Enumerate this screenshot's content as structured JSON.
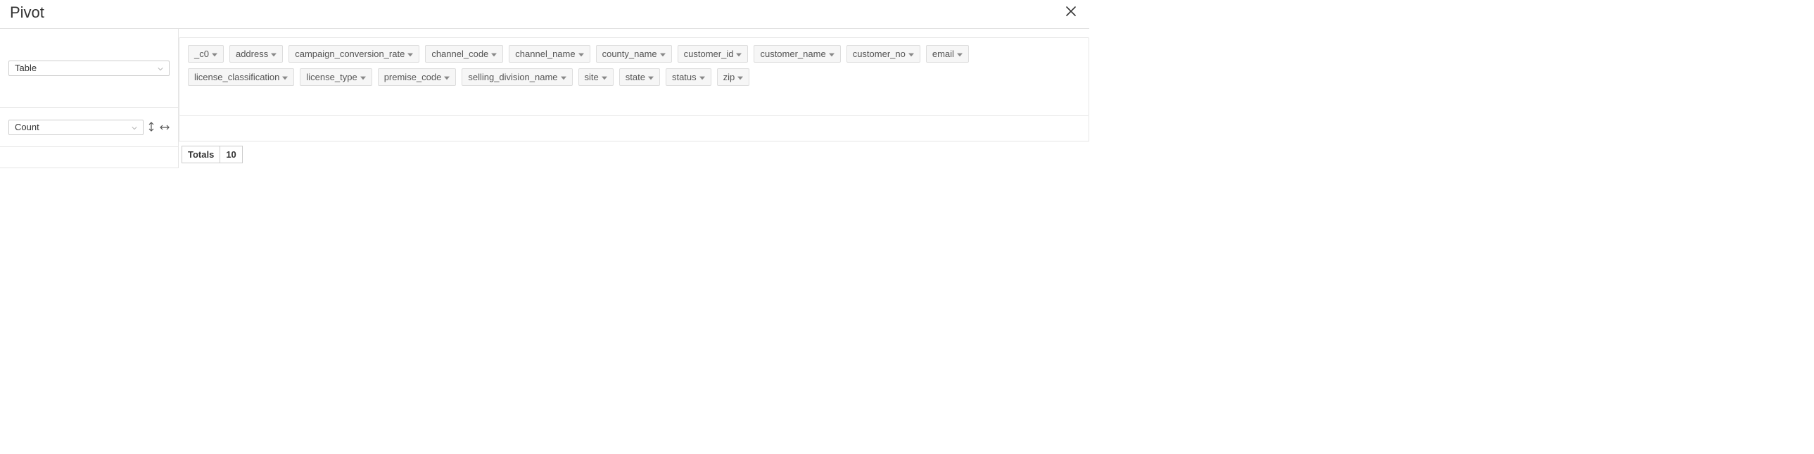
{
  "header": {
    "title": "Pivot"
  },
  "left": {
    "renderer": "Table",
    "aggregator": "Count"
  },
  "fields": {
    "unused": [
      "_c0",
      "address",
      "campaign_conversion_rate",
      "channel_code",
      "channel_name",
      "county_name",
      "customer_id",
      "customer_name",
      "customer_no",
      "email",
      "license_classification",
      "license_type",
      "premise_code",
      "selling_division_name",
      "site",
      "state",
      "status",
      "zip"
    ]
  },
  "totals": {
    "label": "Totals",
    "value": "10"
  }
}
